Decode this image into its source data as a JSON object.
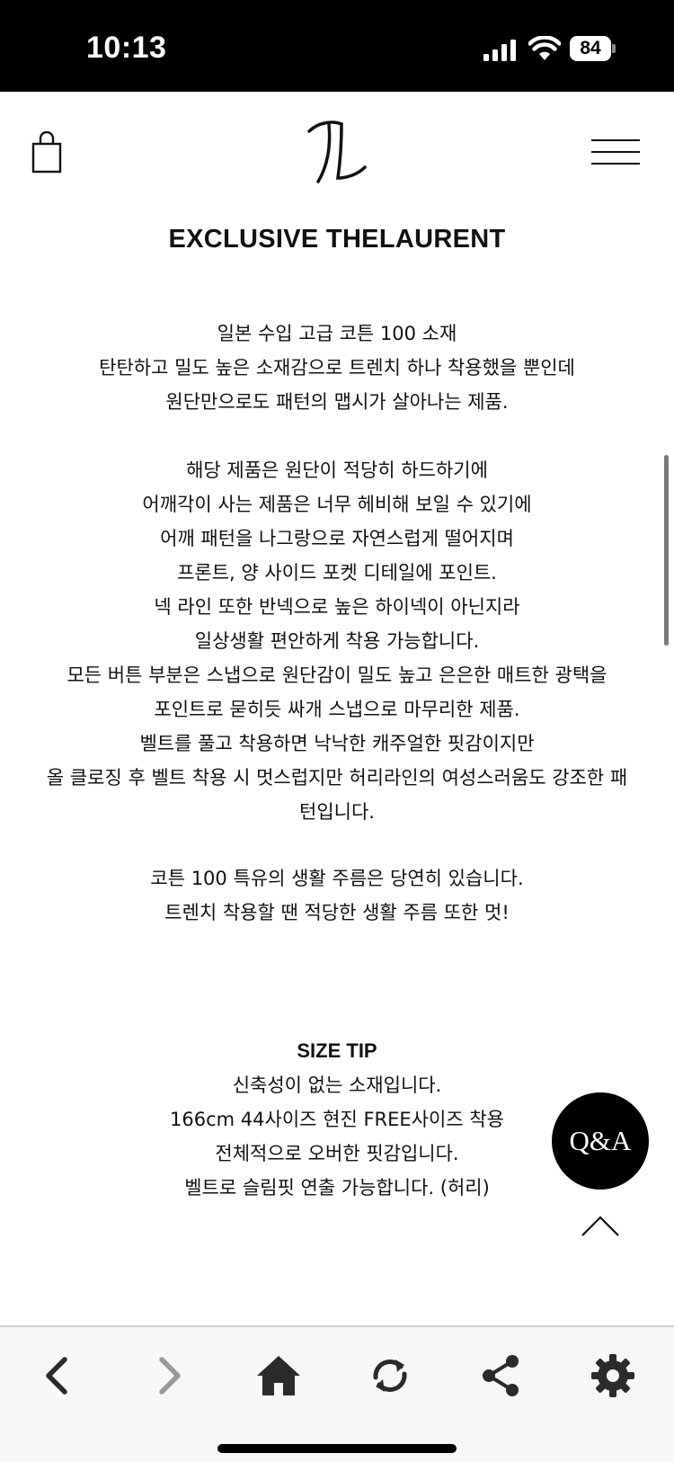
{
  "status_bar": {
    "time": "10:13",
    "battery": "84",
    "icons": [
      "signal-icon",
      "wifi-icon",
      "battery-icon"
    ]
  },
  "header": {
    "icons": [
      "shopping-bag-icon",
      "thelaurent-logo",
      "hamburger-menu-icon"
    ]
  },
  "page_heading": "EXCLUSIVE THELAURENT",
  "description": {
    "block_1": [
      "일본 수입 고급 코튼 100 소재",
      "탄탄하고 밀도 높은 소재감으로 트렌치 하나 착용했을 뿐인데",
      "원단만으로도 패턴의 맵시가 살아나는 제품."
    ],
    "block_2": [
      "해당 제품은 원단이 적당히 하드하기에",
      "어깨각이 사는 제품은 너무 헤비해 보일 수 있기에",
      "어깨 패턴을 나그랑으로 자연스럽게 떨어지며",
      "프론트, 양 사이드 포켓 디테일에 포인트.",
      "넥 라인 또한 반넥으로 높은 하이넥이 아닌지라",
      "일상생활 편안하게 착용 가능합니다.",
      "모든 버튼 부분은 스냅으로 원단감이 밀도 높고 은은한 매트한 광택을",
      "포인트로 묻히듯 싸개 스냅으로 마무리한 제품.",
      "벨트를 풀고 착용하면 낙낙한 캐주얼한 핏감이지만",
      "올 클로징 후 벨트 착용 시 멋스럽지만 허리라인의 여성스러움도 강조한 패",
      "턴입니다."
    ],
    "block_3": [
      "코튼 100 특유의 생활 주름은 당연히 있습니다.",
      "트렌치 착용할 땐 적당한 생활 주름 또한 멋!"
    ]
  },
  "size_tip": {
    "title": "SIZE TIP",
    "lines": [
      "신축성이 없는 소재입니다.",
      "166cm 44사이즈 현진 FREE사이즈 착용",
      "전체적으로 오버한 핏감입니다.",
      "벨트로 슬림핏 연출 가능합니다. (허리)"
    ]
  },
  "qa_button": "Q&A",
  "toolbar": {
    "icons": [
      "back-icon",
      "forward-icon",
      "home-icon",
      "refresh-icon",
      "share-icon",
      "settings-icon"
    ]
  },
  "colors": {
    "status_bar_bg": "#000000",
    "toolbar_bg": "#f7f7f8",
    "qa_bg": "#000000",
    "text": "#111111",
    "forward_disabled": "#9a9a9a"
  }
}
